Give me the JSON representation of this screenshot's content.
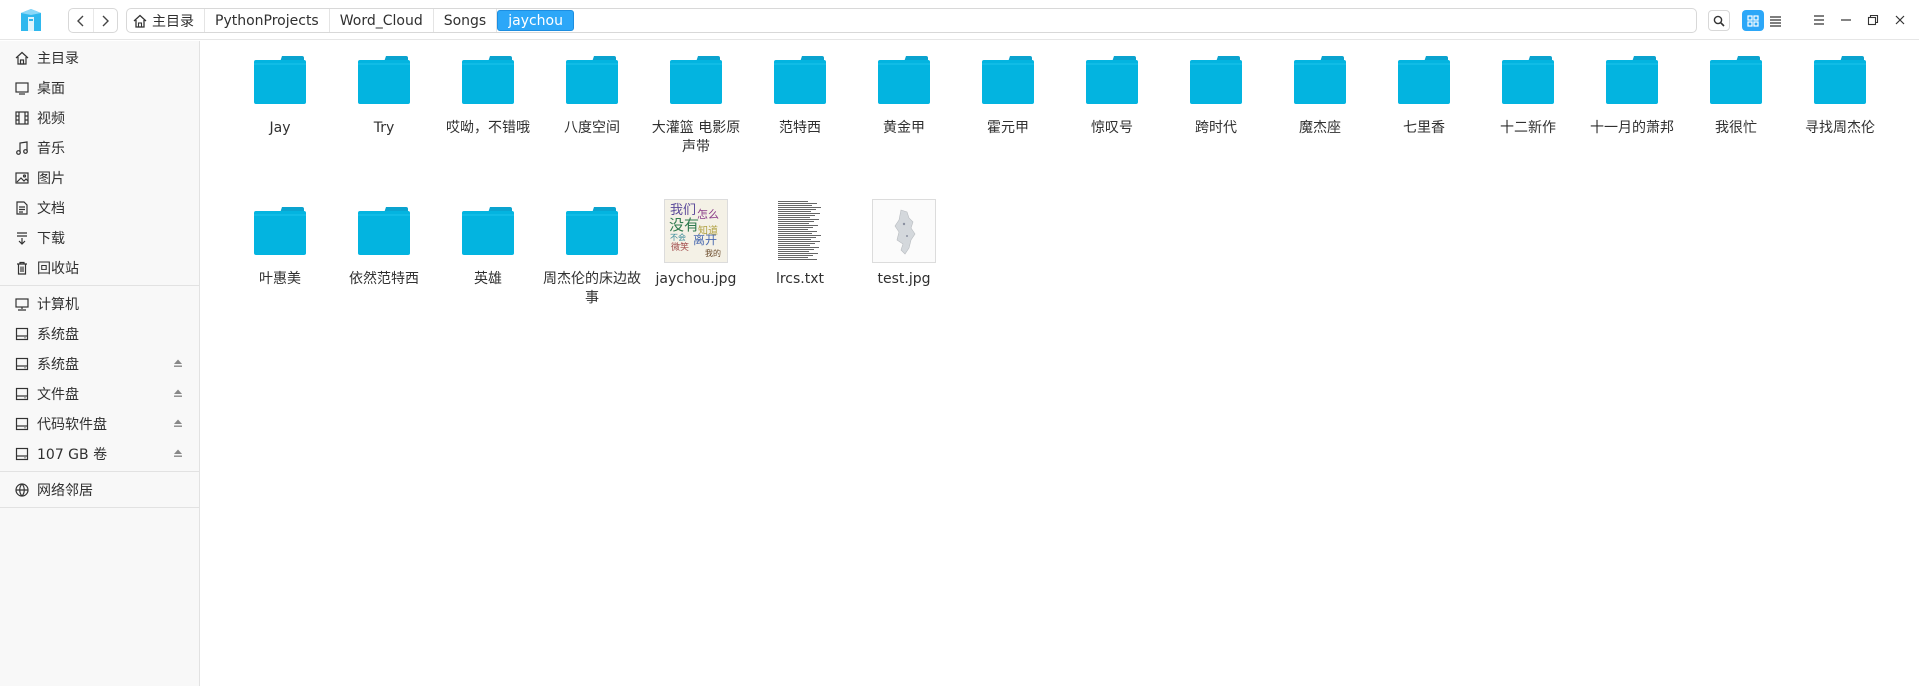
{
  "breadcrumb": [
    "主目录",
    "PythonProjects",
    "Word_Cloud",
    "Songs",
    "jaychou"
  ],
  "sidebar": {
    "group1": [
      {
        "label": "主目录",
        "icon": "home-icon"
      },
      {
        "label": "桌面",
        "icon": "desktop-icon"
      },
      {
        "label": "视频",
        "icon": "video-icon"
      },
      {
        "label": "音乐",
        "icon": "music-icon"
      },
      {
        "label": "图片",
        "icon": "picture-icon"
      },
      {
        "label": "文档",
        "icon": "document-icon"
      },
      {
        "label": "下载",
        "icon": "download-icon"
      },
      {
        "label": "回收站",
        "icon": "trash-icon"
      }
    ],
    "group2": [
      {
        "label": "计算机",
        "icon": "computer-icon",
        "eject": false
      },
      {
        "label": "系统盘",
        "icon": "disk-icon",
        "eject": false
      },
      {
        "label": "系统盘",
        "icon": "disk-icon",
        "eject": true
      },
      {
        "label": "文件盘",
        "icon": "disk-icon",
        "eject": true
      },
      {
        "label": "代码软件盘",
        "icon": "disk-icon",
        "eject": true
      },
      {
        "label": "107 GB 卷",
        "icon": "disk-icon",
        "eject": true
      }
    ],
    "group3": [
      {
        "label": "网络邻居",
        "icon": "network-icon"
      }
    ]
  },
  "files": [
    {
      "name": "Jay",
      "type": "folder"
    },
    {
      "name": "Try",
      "type": "folder"
    },
    {
      "name": "哎呦，不错哦",
      "type": "folder"
    },
    {
      "name": "八度空间",
      "type": "folder"
    },
    {
      "name": "大灌篮 电影原声带",
      "type": "folder"
    },
    {
      "name": "范特西",
      "type": "folder"
    },
    {
      "name": "黄金甲",
      "type": "folder"
    },
    {
      "name": "霍元甲",
      "type": "folder"
    },
    {
      "name": "惊叹号",
      "type": "folder"
    },
    {
      "name": "跨时代",
      "type": "folder"
    },
    {
      "name": "魔杰座",
      "type": "folder"
    },
    {
      "name": "七里香",
      "type": "folder"
    },
    {
      "name": "十二新作",
      "type": "folder"
    },
    {
      "name": "十一月的萧邦",
      "type": "folder"
    },
    {
      "name": "我很忙",
      "type": "folder"
    },
    {
      "name": "寻找周杰伦",
      "type": "folder"
    },
    {
      "name": "叶惠美",
      "type": "folder"
    },
    {
      "name": "依然范特西",
      "type": "folder"
    },
    {
      "name": "英雄",
      "type": "folder"
    },
    {
      "name": "周杰伦的床边故事",
      "type": "folder"
    },
    {
      "name": "jaychou.jpg",
      "type": "wordcloud-image",
      "words": [
        "我们",
        "怎么",
        "没有",
        "知道",
        "离开",
        "微笑",
        "不会",
        "我的"
      ]
    },
    {
      "name": "lrcs.txt",
      "type": "text"
    },
    {
      "name": "test.jpg",
      "type": "map-image"
    }
  ],
  "colors": {
    "accent": "#2ca7f8",
    "folder": "#03b4e0",
    "folder_tab": "#0aa3cf"
  }
}
